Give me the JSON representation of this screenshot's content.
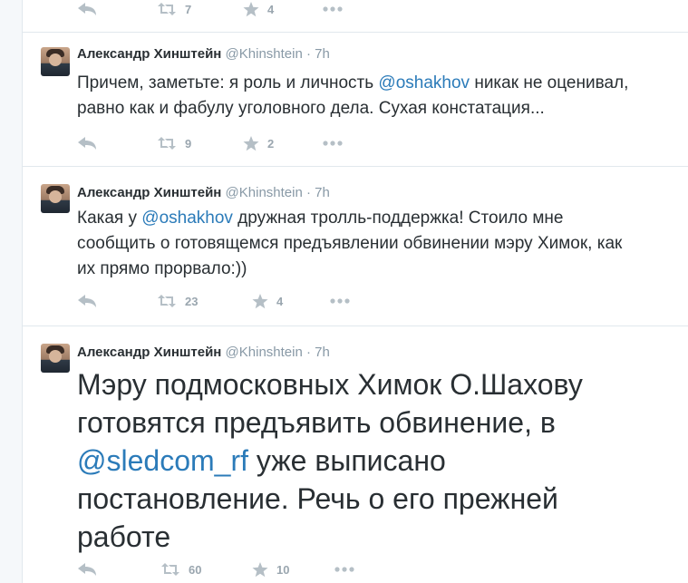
{
  "tweets": [
    {
      "name": "",
      "handle": "",
      "time": "",
      "text_parts": [],
      "retweets": "7",
      "favorites": "4"
    },
    {
      "name": "Александр Хинштейн",
      "handle": "@Khinshtein",
      "time": "7h",
      "line1_a": "Причем, заметьте: я роль и личность ",
      "line1_mention": "@oshakhov",
      "line1_b": " никак не оценивал,",
      "line2": "равно как и фабулу уголовного дела. Сухая констатация...",
      "retweets": "9",
      "favorites": "2"
    },
    {
      "name": "Александр Хинштейн",
      "handle": "@Khinshtein",
      "time": "7h",
      "line1_a": "Какая у ",
      "line1_mention": "@oshakhov",
      "line1_b": " дружная тролль-поддержка! Стоило мне",
      "line2": "сообщить о готовящемся предъявлении обвинении мэру Химок, как",
      "line3": "их прямо прорвало:))",
      "retweets": "23",
      "favorites": "4"
    },
    {
      "name": "Александр Хинштейн",
      "handle": "@Khinshtein",
      "time": "7h",
      "line1": "Мэру подмосковных Химок О.Шахову",
      "line2": "готовятся предъявить обвинение, в",
      "line3_mention": "@sledcom_rf",
      "line3_b": " уже выписано",
      "line4": "постановление. Речь о его прежней",
      "line5": "работе",
      "retweets": "60",
      "favorites": "10"
    }
  ],
  "separator": "·",
  "icons": [
    "reply-icon",
    "retweet-icon",
    "favorite-icon",
    "more-icon"
  ],
  "colors": {
    "link": "#2b7bb9",
    "muted": "#8899a6",
    "icon": "#b5bfc6"
  }
}
